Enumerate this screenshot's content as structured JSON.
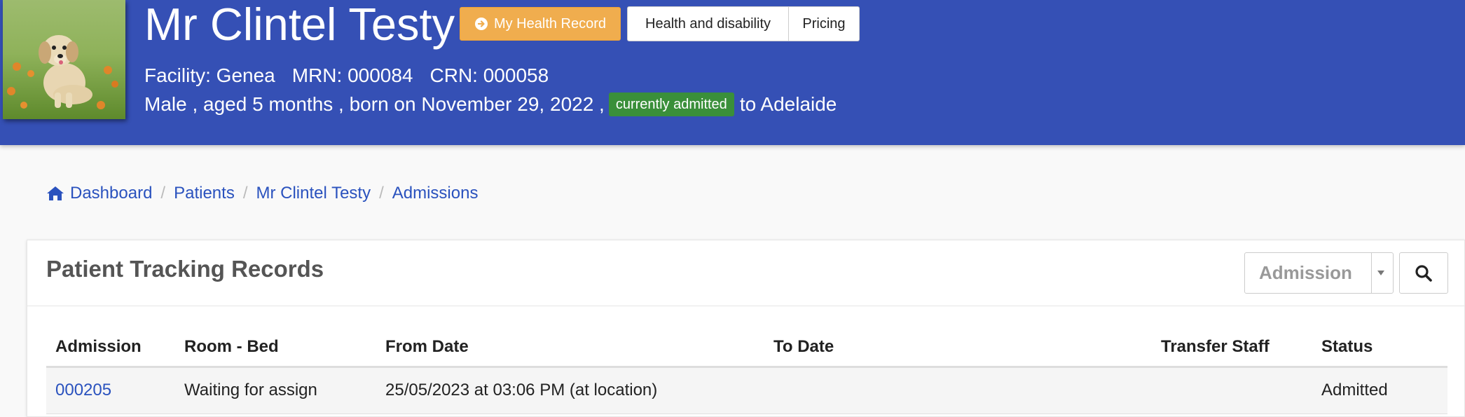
{
  "header": {
    "patient_name": "Mr Clintel Testy",
    "health_record_button": "My Health Record",
    "health_disability_button": "Health and disability",
    "pricing_button": "Pricing",
    "facility": "Facility: Genea",
    "mrn": "MRN: 000084",
    "crn": "CRN: 000058",
    "demographics": "Male , aged 5 months , born on November 29, 2022 ,",
    "admission_badge": "currently admitted",
    "location": "to Adelaide",
    "colors": {
      "banner": "#3550b5",
      "health_record_button": "#f0ad4e",
      "admitted_badge": "#3a8f3a"
    }
  },
  "breadcrumb": {
    "items": [
      {
        "label": "Dashboard",
        "icon": "home-icon"
      },
      {
        "label": "Patients"
      },
      {
        "label": "Mr Clintel Testy"
      },
      {
        "label": "Admissions"
      }
    ]
  },
  "panel": {
    "title": "Patient Tracking Records",
    "filter_select": {
      "value": "Admission"
    },
    "search_button_icon": "search-icon",
    "table": {
      "columns": [
        "Admission",
        "Room - Bed",
        "From Date",
        "To Date",
        "Transfer Staff",
        "Status"
      ],
      "rows": [
        {
          "admission": "000205",
          "room_bed": "Waiting for assign",
          "from_date": "25/05/2023 at 03:06 PM (at location)",
          "to_date": "",
          "transfer_staff": "",
          "status": "Admitted"
        }
      ]
    }
  }
}
